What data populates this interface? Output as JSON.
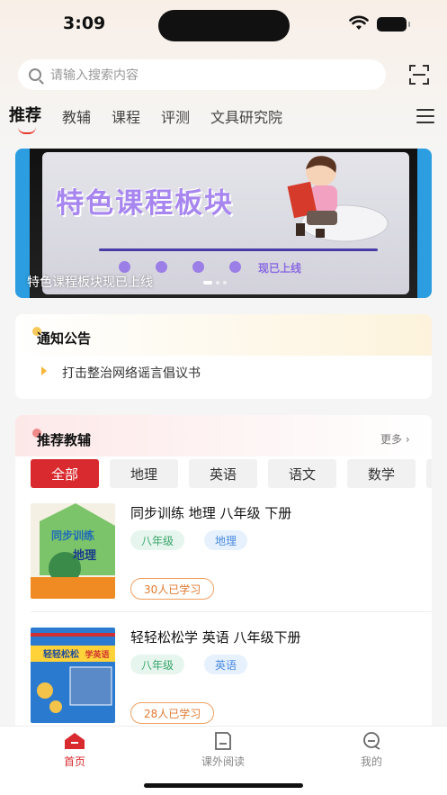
{
  "status_bar": {
    "time": "3:09"
  },
  "search": {
    "placeholder": "请输入搜索内容"
  },
  "tabs": [
    {
      "label": "推荐",
      "active": true
    },
    {
      "label": "教辅"
    },
    {
      "label": "课程"
    },
    {
      "label": "评测"
    },
    {
      "label": "文具研究院"
    }
  ],
  "banner": {
    "title": "特色课程板块",
    "subtitle": "现已上线",
    "caption": "特色课程板块现已上线"
  },
  "notice": {
    "title": "通知公告",
    "items": [
      "打击整治网络谣言倡议书"
    ]
  },
  "recommended": {
    "title": "推荐教辅",
    "more_label": "更多 ›",
    "filters": [
      {
        "label": "全部",
        "active": true
      },
      {
        "label": "地理"
      },
      {
        "label": "英语"
      },
      {
        "label": "语文"
      },
      {
        "label": "数学"
      }
    ],
    "books": [
      {
        "title": "同步训练 地理 八年级 下册",
        "tags": [
          "八年级",
          "地理"
        ],
        "learned": "30人已学习",
        "cover_text": "同步训练",
        "cover_subject": "地理"
      },
      {
        "title": "轻轻松松学 英语 八年级下册",
        "tags": [
          "八年级",
          "英语"
        ],
        "learned": "28人已学习",
        "cover_text": "轻轻松松",
        "cover_subject": "学英语"
      }
    ]
  },
  "bottom_nav": [
    {
      "label": "首页",
      "icon": "home-icon",
      "active": true
    },
    {
      "label": "课外阅读",
      "icon": "book-icon"
    },
    {
      "label": "我的",
      "icon": "profile-icon"
    }
  ],
  "colors": {
    "accent": "#d92b2f",
    "banner_blue": "#2b9de0",
    "tag_green": "#3aa56b",
    "tag_blue": "#4a8ae0",
    "learned_orange": "#e07a32"
  }
}
